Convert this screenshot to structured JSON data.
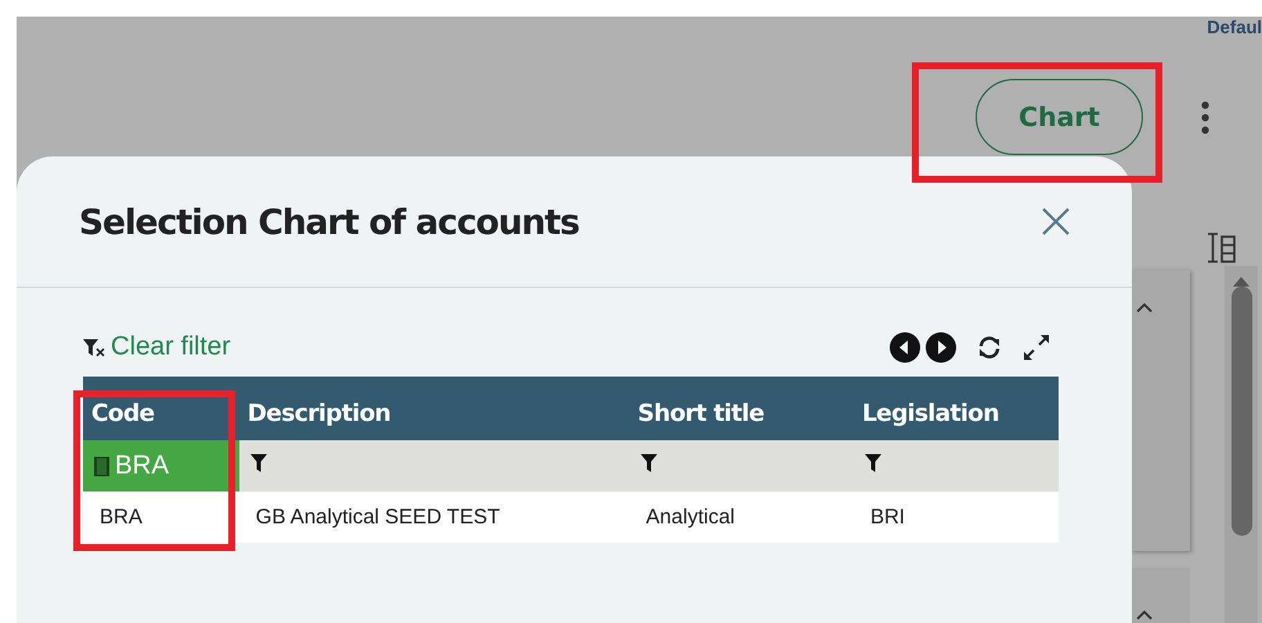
{
  "header": {
    "user_label": "Defaul"
  },
  "toolbar": {
    "chart_button": {
      "label": "Chart",
      "highlighted": true
    }
  },
  "dialog": {
    "title": "Selection Chart of accounts",
    "clear_filter": "Clear filter",
    "table": {
      "columns": [
        {
          "label": "Code",
          "highlighted": true
        },
        {
          "label": "Description",
          "highlighted": false
        },
        {
          "label": "Short title",
          "highlighted": false
        },
        {
          "label": "Legislation",
          "highlighted": false
        }
      ],
      "filters": [
        {
          "active": true,
          "value": "BRA"
        },
        {
          "active": false
        },
        {
          "active": false
        },
        {
          "active": false
        }
      ],
      "rows": [
        [
          "BRA",
          "GB Analytical SEED TEST",
          "Analytical",
          "BRI"
        ]
      ]
    }
  }
}
